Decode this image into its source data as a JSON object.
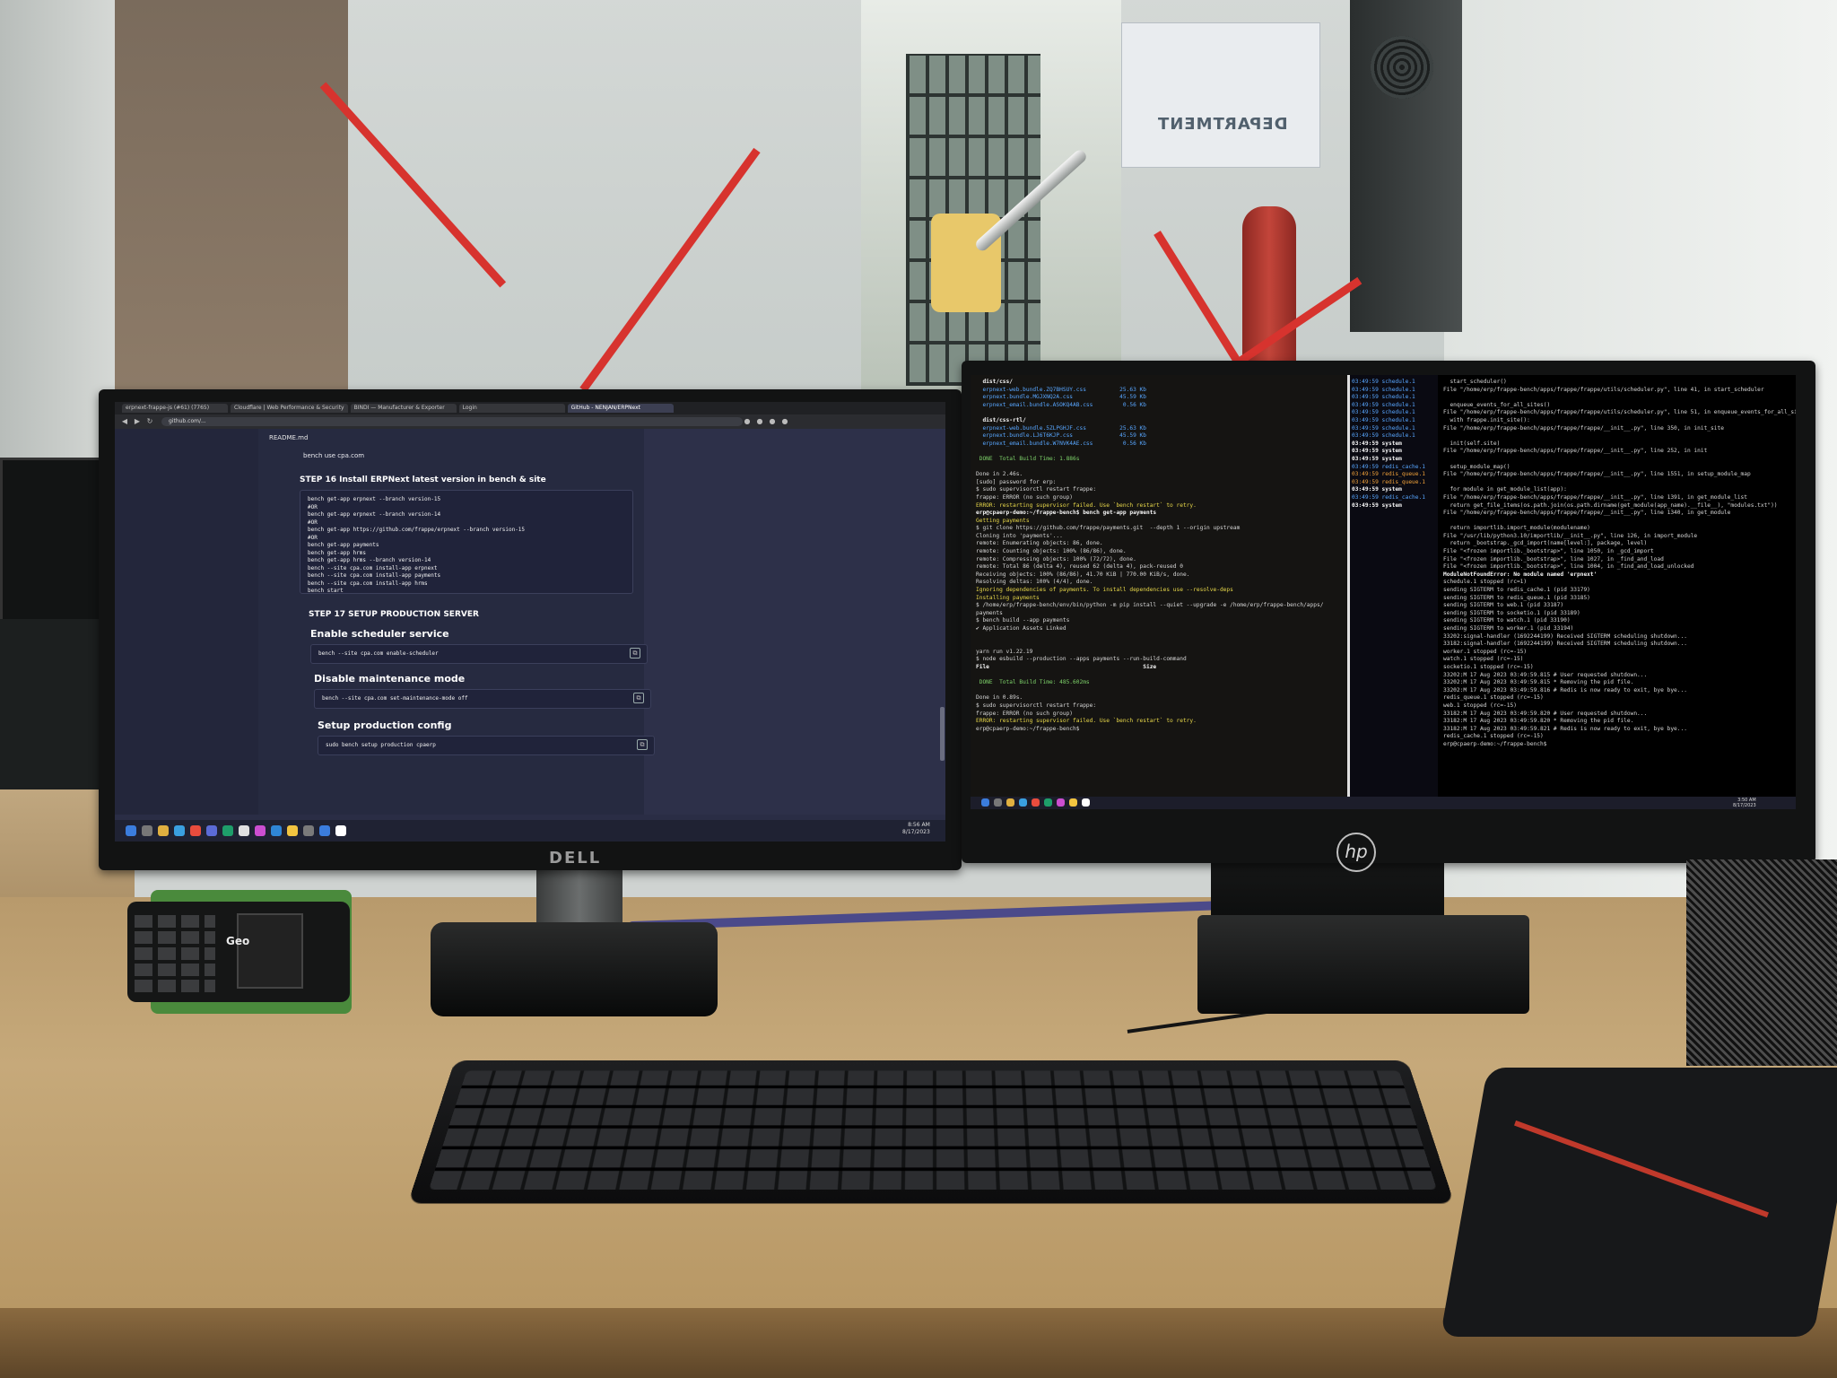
{
  "scene": {
    "dept_sign": "DEPARTMENT",
    "dell_logo": "DELL",
    "hp_logo": "hp",
    "phone_brand": "Geo"
  },
  "browser": {
    "tabs": [
      {
        "label": "erpnext-frappe-js (#61) (7765)"
      },
      {
        "label": "Cloudflare | Web Performance & Security"
      },
      {
        "label": "BINDI — Manufacturer & Exporter"
      },
      {
        "label": "Login"
      },
      {
        "label": "GitHub - NENJAN/ERPNext"
      }
    ],
    "url": "github.com/...",
    "readme_title": "README.md",
    "top_code": "bench use cpa.com",
    "step16_heading": "STEP 16 Install ERPNext latest version in bench & site",
    "step16_code": [
      "bench get-app erpnext --branch version-15",
      "#OR",
      "bench get-app erpnext --branch version-14",
      "#OR",
      "bench get-app https://github.com/frappe/erpnext --branch version-15",
      "#OR",
      "bench get-app payments",
      "bench get-app hrms",
      "bench get-app hrms --branch version-14",
      "bench --site cpa.com install-app erpnext",
      "bench --site cpa.com install-app payments",
      "bench --site cpa.com install-app hrms",
      "bench start"
    ],
    "step17_heading": "STEP 17 SETUP PRODUCTION SERVER",
    "sections": [
      {
        "heading": "Enable scheduler service",
        "code": "bench --site cpa.com enable-scheduler"
      },
      {
        "heading": "Disable maintenance mode",
        "code": "bench --site cpa.com set-maintenance-mode off"
      },
      {
        "heading": "Setup production config",
        "code": "sudo bench setup production cpaerp"
      }
    ],
    "clock": {
      "time": "8:56 AM",
      "date": "8/17/2023"
    }
  },
  "terminal_left": {
    "lines": [
      {
        "t": "  dist/css/",
        "c": "t-white"
      },
      {
        "t": "  erpnext-web.bundle.ZQ7BHSUY.css          25.63 Kb",
        "c": "t-blue"
      },
      {
        "t": "  erpnext.bundle.MGJXNQ2A.css              45.59 Kb",
        "c": "t-blue"
      },
      {
        "t": "  erpnext_email.bundle.ASOKQ4AB.css         0.56 Kb",
        "c": "t-blue"
      },
      {
        "t": ""
      },
      {
        "t": "  dist/css-rtl/",
        "c": "t-white"
      },
      {
        "t": "  erpnext-web.bundle.5ZLPGHJF.css          25.63 Kb",
        "c": "t-blue"
      },
      {
        "t": "  erpnext.bundle.LJ6T6KJP.css              45.59 Kb",
        "c": "t-blue"
      },
      {
        "t": "  erpnext_email.bundle.W7NVK4AE.css         0.56 Kb",
        "c": "t-blue"
      },
      {
        "t": ""
      },
      {
        "t": " DONE  Total Build Time: 1.886s",
        "c": "t-green"
      },
      {
        "t": ""
      },
      {
        "t": "Done in 2.46s."
      },
      {
        "t": "[sudo] password for erp:"
      },
      {
        "t": "$ sudo supervisorctl restart frappe:"
      },
      {
        "t": "frappe: ERROR (no such group)"
      },
      {
        "t": "ERROR: restarting supervisor failed. Use `bench restart` to retry.",
        "c": "t-yellow"
      },
      {
        "t": "erp@cpaerp-demo:~/frappe-bench$ bench get-app payments",
        "c": "t-white"
      },
      {
        "t": "Getting payments",
        "c": "t-yellow"
      },
      {
        "t": "$ git clone https://github.com/frappe/payments.git  --depth 1 --origin upstream"
      },
      {
        "t": "Cloning into 'payments'..."
      },
      {
        "t": "remote: Enumerating objects: 86, done."
      },
      {
        "t": "remote: Counting objects: 100% (86/86), done."
      },
      {
        "t": "remote: Compressing objects: 100% (72/72), done."
      },
      {
        "t": "remote: Total 86 (delta 4), reused 62 (delta 4), pack-reused 0"
      },
      {
        "t": "Receiving objects: 100% (86/86), 41.70 KiB | 770.00 KiB/s, done."
      },
      {
        "t": "Resolving deltas: 100% (4/4), done."
      },
      {
        "t": "Ignoring dependencies of payments. To install dependencies use --resolve-deps",
        "c": "t-yellow"
      },
      {
        "t": "Installing payments",
        "c": "t-yellow"
      },
      {
        "t": "$ /home/erp/frappe-bench/env/bin/python -m pip install --quiet --upgrade -e /home/erp/frappe-bench/apps/"
      },
      {
        "t": "payments"
      },
      {
        "t": "$ bench build --app payments"
      },
      {
        "t": "✔ Application Assets Linked"
      },
      {
        "t": ""
      },
      {
        "t": ""
      },
      {
        "t": "yarn run v1.22.19"
      },
      {
        "t": "$ node esbuild --production --apps payments --run-build-command"
      },
      {
        "t": "File                                              Size",
        "c": "t-white"
      },
      {
        "t": ""
      },
      {
        "t": " DONE  Total Build Time: 485.602ms",
        "c": "t-green"
      },
      {
        "t": ""
      },
      {
        "t": "Done in 0.89s."
      },
      {
        "t": "$ sudo supervisorctl restart frappe:"
      },
      {
        "t": "frappe: ERROR (no such group)"
      },
      {
        "t": "ERROR: restarting supervisor failed. Use `bench restart` to retry.",
        "c": "t-yellow"
      },
      {
        "t": "erp@cpaerp-demo:~/frappe-bench$"
      }
    ]
  },
  "terminal_right": {
    "lines": [
      {
        "t": "  start_scheduler()"
      },
      {
        "t": "File \"/home/erp/frappe-bench/apps/frappe/frappe/utils/scheduler.py\", line 41, in start_scheduler"
      },
      {
        "t": ""
      },
      {
        "t": "  enqueue_events_for_all_sites()"
      },
      {
        "t": "File \"/home/erp/frappe-bench/apps/frappe/frappe/utils/scheduler.py\", line 51, in enqueue_events_for_all_sites"
      },
      {
        "t": "  with frappe.init_site():"
      },
      {
        "t": "File \"/home/erp/frappe-bench/apps/frappe/frappe/__init__.py\", line 350, in init_site"
      },
      {
        "t": ""
      },
      {
        "t": "  init(self.site)"
      },
      {
        "t": "File \"/home/erp/frappe-bench/apps/frappe/frappe/__init__.py\", line 252, in init"
      },
      {
        "t": ""
      },
      {
        "t": "  setup_module_map()"
      },
      {
        "t": "File \"/home/erp/frappe-bench/apps/frappe/frappe/__init__.py\", line 1551, in setup_module_map"
      },
      {
        "t": ""
      },
      {
        "t": "  for module in get_module_list(app):"
      },
      {
        "t": "File \"/home/erp/frappe-bench/apps/frappe/frappe/__init__.py\", line 1391, in get_module_list"
      },
      {
        "t": "  return get_file_items(os.path.join(os.path.dirname(get_module(app_name).__file__), \"modules.txt\"))"
      },
      {
        "t": "File \"/home/erp/frappe-bench/apps/frappe/frappe/__init__.py\", line 1340, in get_module"
      },
      {
        "t": ""
      },
      {
        "t": "  return importlib.import_module(modulename)"
      },
      {
        "t": "File \"/usr/lib/python3.10/importlib/__init__.py\", line 126, in import_module"
      },
      {
        "t": "  return _bootstrap._gcd_import(name[level:], package, level)"
      },
      {
        "t": "File \"<frozen importlib._bootstrap>\", line 1050, in _gcd_import"
      },
      {
        "t": "File \"<frozen importlib._bootstrap>\", line 1027, in _find_and_load"
      },
      {
        "t": "File \"<frozen importlib._bootstrap>\", line 1004, in _find_and_load_unlocked"
      },
      {
        "t": "ModuleNotFoundError: No module named 'erpnext'",
        "c": "t-white"
      },
      {
        "t": "schedule.1 stopped (rc=1)"
      },
      {
        "t": "sending SIGTERM to redis_cache.1 (pid 33179)"
      },
      {
        "t": "sending SIGTERM to redis_queue.1 (pid 33185)"
      },
      {
        "t": "sending SIGTERM to web.1 (pid 33187)"
      },
      {
        "t": "sending SIGTERM to socketio.1 (pid 33189)"
      },
      {
        "t": "sending SIGTERM to watch.1 (pid 33190)"
      },
      {
        "t": "sending SIGTERM to worker.1 (pid 33194)"
      },
      {
        "t": "33202:signal-handler (1692244199) Received SIGTERM scheduling shutdown..."
      },
      {
        "t": "33182:signal-handler (1692244199) Received SIGTERM scheduling shutdown..."
      },
      {
        "t": "worker.1 stopped (rc=-15)"
      },
      {
        "t": "watch.1 stopped (rc=-15)"
      },
      {
        "t": "socketio.1 stopped (rc=-15)"
      },
      {
        "t": "33202:M 17 Aug 2023 03:49:59.815 # User requested shutdown..."
      },
      {
        "t": "33202:M 17 Aug 2023 03:49:59.815 * Removing the pid file."
      },
      {
        "t": "33202:M 17 Aug 2023 03:49:59.816 # Redis is now ready to exit, bye bye..."
      },
      {
        "t": "redis_queue.1 stopped (rc=-15)"
      },
      {
        "t": "web.1 stopped (rc=-15)"
      },
      {
        "t": "33182:M 17 Aug 2023 03:49:59.820 # User requested shutdown..."
      },
      {
        "t": "33182:M 17 Aug 2023 03:49:59.820 * Removing the pid file."
      },
      {
        "t": "33182:M 17 Aug 2023 03:49:59.821 # Redis is now ready to exit, bye bye..."
      },
      {
        "t": "redis_cache.1 stopped (rc=-15)"
      },
      {
        "t": "erp@cpaerp-demo:~/frappe-bench$"
      }
    ],
    "gutter": [
      {
        "t": "03:49:59 schedule.1",
        "c": "t-blue"
      },
      {
        "t": "03:49:59 schedule.1",
        "c": "t-blue"
      },
      {
        "t": "03:49:59 schedule.1",
        "c": "t-blue"
      },
      {
        "t": "03:49:59 schedule.1",
        "c": "t-blue"
      },
      {
        "t": "03:49:59 schedule.1",
        "c": "t-blue"
      },
      {
        "t": "03:49:59 schedule.1",
        "c": "t-blue"
      },
      {
        "t": "03:49:59 schedule.1",
        "c": "t-blue"
      },
      {
        "t": "03:49:59 schedule.1",
        "c": "t-blue"
      },
      {
        "t": "03:49:59 system",
        "c": "t-white"
      },
      {
        "t": "03:49:59 system",
        "c": "t-white"
      },
      {
        "t": "03:49:59 system",
        "c": "t-white"
      },
      {
        "t": "03:49:59 redis_cache.1",
        "c": "t-blue"
      },
      {
        "t": "03:49:59 redis_queue.1",
        "c": "t-orange"
      },
      {
        "t": "03:49:59 redis_queue.1",
        "c": "t-orange"
      },
      {
        "t": "03:49:59 system",
        "c": "t-white"
      },
      {
        "t": "03:49:59 redis_cache.1",
        "c": "t-blue"
      },
      {
        "t": "03:49:59 system",
        "c": "t-white"
      }
    ],
    "clock": {
      "time": "3:50 AM",
      "date": "8/17/2023"
    }
  },
  "colors": {
    "dell_screen_bg": "#2a2d45",
    "terminal_bg": "#151412",
    "terminal_yellow": "#e9d94a",
    "terminal_green": "#7ed36a",
    "terminal_blue": "#58a6ff"
  }
}
